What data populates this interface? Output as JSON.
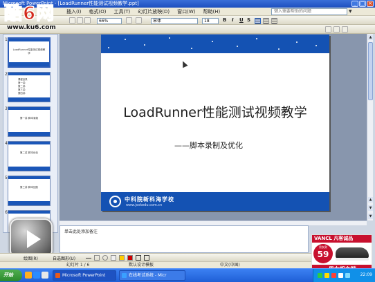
{
  "window": {
    "title": "Microsoft PowerPoint - [LoadRunner性能测试视频教学.ppt]"
  },
  "logo": {
    "prefix": "酷",
    "number": "6",
    "suffix": "网",
    "url": "www.ku6.com"
  },
  "menu": {
    "items": [
      "插入(I)",
      "格式(O)",
      "工具(T)",
      "幻灯片放映(D)",
      "窗口(W)",
      "帮助(H)"
    ],
    "help_placeholder": "键入需要帮助的问题"
  },
  "toolbar": {
    "zoom": "66%",
    "font_name": "宋体",
    "font_size": "18",
    "bold": "B",
    "italic": "I",
    "underline": "U",
    "shadow": "S"
  },
  "thumbnails": [
    {
      "num": "1",
      "text": "LoadRunner性能测试视频教学"
    },
    {
      "num": "2",
      "text": "课程目录"
    },
    {
      "num": "3",
      "text": "第一讲 脚本录制"
    },
    {
      "num": "4",
      "text": "第二讲 脚本优化"
    },
    {
      "num": "5",
      "text": "第三讲 脚本回放"
    },
    {
      "num": "6",
      "text": ""
    }
  ],
  "thumb2_lines": [
    "第一讲:",
    "第二讲:",
    "第三讲:",
    "第四讲:"
  ],
  "slide": {
    "title": "LoadRunner性能测试视频教学",
    "subtitle": "——脚本录制及优化",
    "school_name": "中科院新科海学校",
    "school_url": "www.jsxkedu.com.cn"
  },
  "notes": {
    "placeholder": "单击此处添加备注"
  },
  "drawing": {
    "draw_label": "绘图(R)",
    "autoshapes_label": "自选图形(U)"
  },
  "status": {
    "slide_pos": "幻灯片 1 / 6",
    "design": "默认设计模板",
    "language": "中文(中国)"
  },
  "ad": {
    "brand": "VANCL 凡客诚品",
    "badge_top": "男女款",
    "price": "59",
    "footer": "男女帆布鞋"
  },
  "taskbar": {
    "start_label": "开始",
    "tasks": [
      "Microsoft PowerPoint",
      "在线考试系统 - Micr"
    ],
    "clock": "22:09"
  },
  "colors": {
    "slide_band": "#1452b3",
    "title_bar": "#1d4fbf",
    "ad_red": "#c8102e",
    "logo_red": "#d32a1c"
  }
}
